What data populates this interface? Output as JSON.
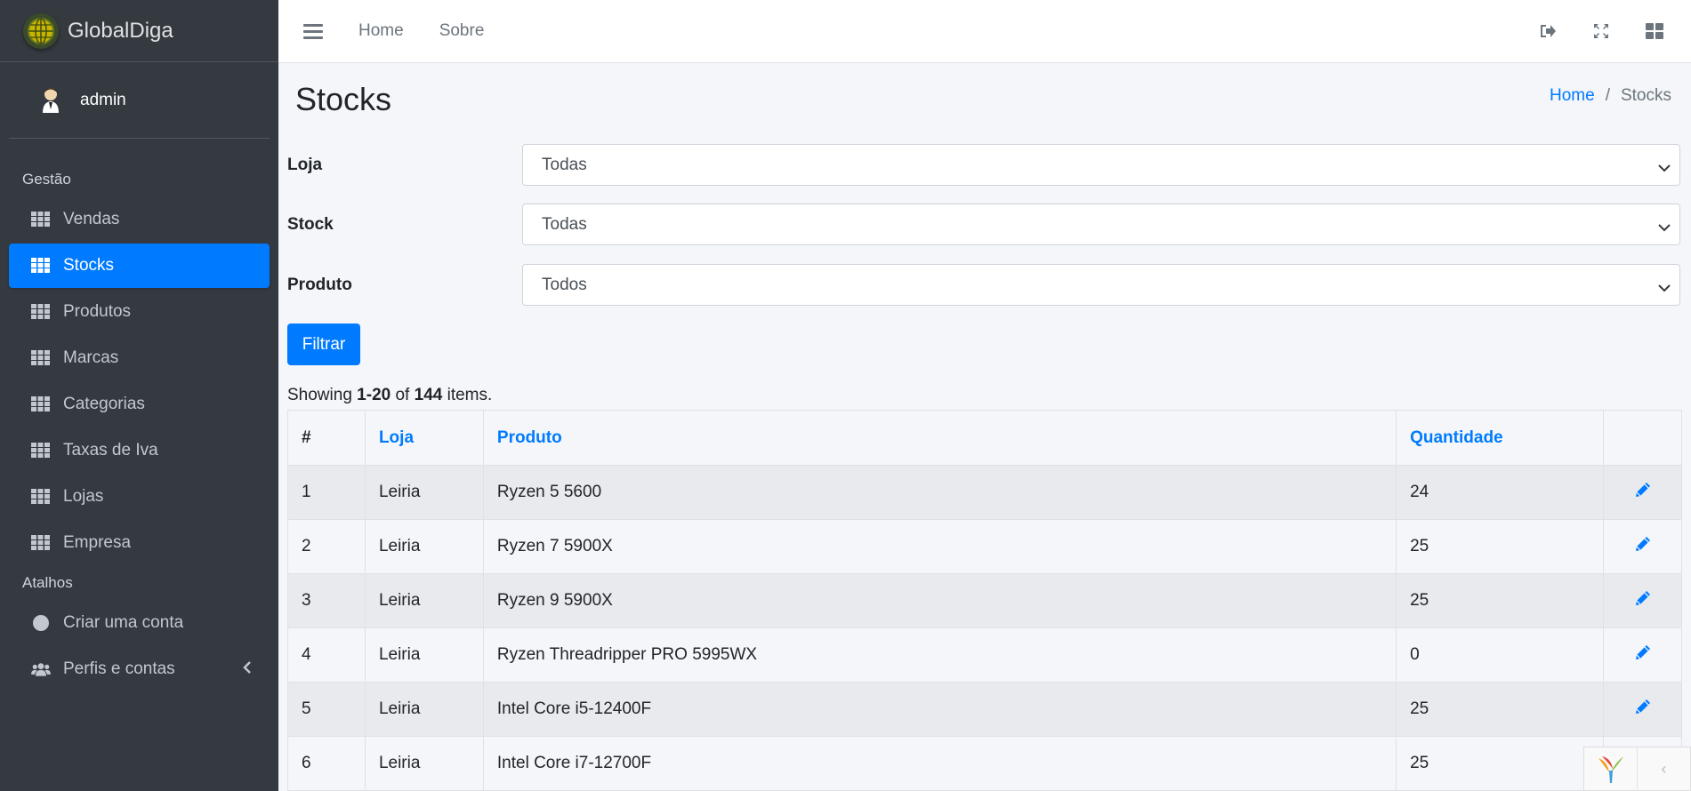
{
  "brand": {
    "name": "GlobalDiga"
  },
  "user": {
    "name": "admin"
  },
  "sidebar": {
    "header_gestao": "Gestão",
    "items": [
      {
        "label": "Vendas",
        "icon": "grid-icon",
        "active": false
      },
      {
        "label": "Stocks",
        "icon": "grid-icon",
        "active": true
      },
      {
        "label": "Produtos",
        "icon": "grid-icon",
        "active": false
      },
      {
        "label": "Marcas",
        "icon": "grid-icon",
        "active": false
      },
      {
        "label": "Categorias",
        "icon": "grid-icon",
        "active": false
      },
      {
        "label": "Taxas de Iva",
        "icon": "grid-icon",
        "active": false
      },
      {
        "label": "Lojas",
        "icon": "grid-icon",
        "active": false
      },
      {
        "label": "Empresa",
        "icon": "grid-icon",
        "active": false
      }
    ],
    "header_atalhos": "Atalhos",
    "shortcuts": [
      {
        "label": "Criar uma conta",
        "icon": "circle-icon"
      },
      {
        "label": "Perfis e contas",
        "icon": "users-icon"
      }
    ]
  },
  "topbar": {
    "links": [
      "Home",
      "Sobre"
    ],
    "icons": [
      "logout-icon",
      "fullscreen-icon",
      "grid-layout-icon"
    ]
  },
  "page": {
    "title": "Stocks",
    "breadcrumb": {
      "home": "Home",
      "separator": "/",
      "current": "Stocks"
    }
  },
  "filters": {
    "loja": {
      "label": "Loja",
      "value": "Todas"
    },
    "stock": {
      "label": "Stock",
      "value": "Todas"
    },
    "produto": {
      "label": "Produto",
      "value": "Todos"
    },
    "button": "Filtrar"
  },
  "summary": {
    "prefix": "Showing",
    "range": "1-20",
    "of": "of",
    "total": "144",
    "suffix": "items."
  },
  "table": {
    "headers": {
      "index": "#",
      "loja": "Loja",
      "produto": "Produto",
      "quantidade": "Quantidade"
    },
    "rows": [
      {
        "n": "1",
        "loja": "Leiria",
        "produto": "Ryzen 5 5600",
        "quantidade": "24"
      },
      {
        "n": "2",
        "loja": "Leiria",
        "produto": "Ryzen 7 5900X",
        "quantidade": "25"
      },
      {
        "n": "3",
        "loja": "Leiria",
        "produto": "Ryzen 9 5900X",
        "quantidade": "25"
      },
      {
        "n": "4",
        "loja": "Leiria",
        "produto": "Ryzen Threadripper PRO 5995WX",
        "quantidade": "0"
      },
      {
        "n": "5",
        "loja": "Leiria",
        "produto": "Intel Core i5-12400F",
        "quantidade": "25"
      },
      {
        "n": "6",
        "loja": "Leiria",
        "produto": "Intel Core i7-12700F",
        "quantidade": "25"
      }
    ]
  },
  "colors": {
    "primary": "#007bff",
    "sidebar": "#343a40",
    "background": "#f4f6f9"
  }
}
